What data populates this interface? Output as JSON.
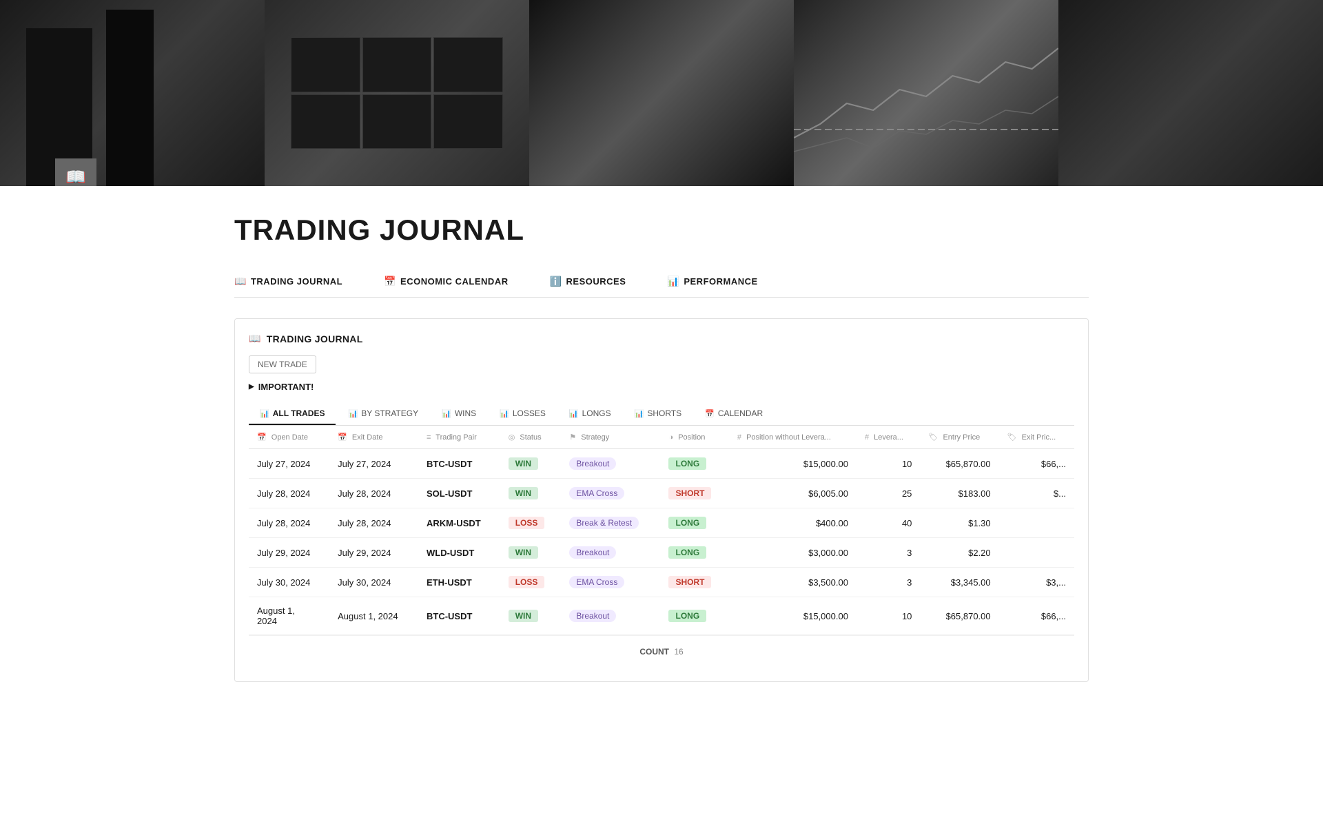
{
  "hero": {
    "segments": [
      {
        "label": "buildings"
      },
      {
        "label": "trading-monitors"
      },
      {
        "label": "skyscrapers"
      },
      {
        "label": "charts"
      },
      {
        "label": "phone-trading"
      }
    ]
  },
  "page": {
    "title": "TRADING JOURNAL",
    "icon": "📖"
  },
  "nav": {
    "items": [
      {
        "id": "trading-journal",
        "icon": "📖",
        "label": "TRADING JOURNAL"
      },
      {
        "id": "economic-calendar",
        "icon": "📅",
        "label": "ECONOMIC CALENDAR"
      },
      {
        "id": "resources",
        "icon": "ℹ️",
        "label": "RESOURCES"
      },
      {
        "id": "performance",
        "icon": "📊",
        "label": "PERFORMANCE"
      }
    ]
  },
  "journal": {
    "title": "TRADING JOURNAL",
    "icon": "📖",
    "new_trade_label": "NEW TRADE",
    "important_label": "IMPORTANT!",
    "tabs": [
      {
        "id": "all-trades",
        "icon": "📊",
        "label": "ALL TRADES",
        "active": true
      },
      {
        "id": "by-strategy",
        "icon": "📊",
        "label": "BY STRATEGY",
        "active": false
      },
      {
        "id": "wins",
        "icon": "📊",
        "label": "WINS",
        "active": false
      },
      {
        "id": "losses",
        "icon": "📊",
        "label": "LOSSES",
        "active": false
      },
      {
        "id": "longs",
        "icon": "📊",
        "label": "LONGS",
        "active": false
      },
      {
        "id": "shorts",
        "icon": "📊",
        "label": "SHORTS",
        "active": false
      },
      {
        "id": "calendar",
        "icon": "📅",
        "label": "CALENDAR",
        "active": false
      }
    ],
    "table": {
      "columns": [
        {
          "id": "open-date",
          "icon": "📅",
          "label": "Open Date"
        },
        {
          "id": "exit-date",
          "icon": "📅",
          "label": "Exit Date"
        },
        {
          "id": "trading-pair",
          "icon": "≡",
          "label": "Trading Pair"
        },
        {
          "id": "status",
          "icon": "◎",
          "label": "Status"
        },
        {
          "id": "strategy",
          "icon": "⚑",
          "label": "Strategy"
        },
        {
          "id": "position",
          "icon": "◑",
          "label": "Position"
        },
        {
          "id": "position-without-leverage",
          "icon": "#",
          "label": "Position without Levera..."
        },
        {
          "id": "leverage",
          "icon": "#",
          "label": "Levera..."
        },
        {
          "id": "entry-price",
          "icon": "🏷",
          "label": "Entry Price"
        },
        {
          "id": "exit-price",
          "icon": "🏷",
          "label": "Exit Pric..."
        }
      ],
      "rows": [
        {
          "open_date": "July 27, 2024",
          "exit_date": "July 27, 2024",
          "trading_pair": "BTC-USDT",
          "status": "WIN",
          "status_type": "win",
          "strategy": "Breakout",
          "position": "LONG",
          "position_type": "long",
          "position_without_leverage": "$15,000.00",
          "leverage": "10",
          "entry_price": "$65,870.00",
          "exit_price": "$66,..."
        },
        {
          "open_date": "July 28, 2024",
          "exit_date": "July 28, 2024",
          "trading_pair": "SOL-USDT",
          "status": "WIN",
          "status_type": "win",
          "strategy": "EMA Cross",
          "position": "SHORT",
          "position_type": "short",
          "position_without_leverage": "$6,005.00",
          "leverage": "25",
          "entry_price": "$183.00",
          "exit_price": "$..."
        },
        {
          "open_date": "July 28, 2024",
          "exit_date": "July 28, 2024",
          "trading_pair": "ARKM-USDT",
          "status": "LOSS",
          "status_type": "loss",
          "strategy": "Break & Retest",
          "position": "LONG",
          "position_type": "long",
          "position_without_leverage": "$400.00",
          "leverage": "40",
          "entry_price": "$1.30",
          "exit_price": ""
        },
        {
          "open_date": "July 29, 2024",
          "exit_date": "July 29, 2024",
          "trading_pair": "WLD-USDT",
          "status": "WIN",
          "status_type": "win",
          "strategy": "Breakout",
          "position": "LONG",
          "position_type": "long",
          "position_without_leverage": "$3,000.00",
          "leverage": "3",
          "entry_price": "$2.20",
          "exit_price": ""
        },
        {
          "open_date": "July 30, 2024",
          "exit_date": "July 30, 2024",
          "trading_pair": "ETH-USDT",
          "status": "LOSS",
          "status_type": "loss",
          "strategy": "EMA Cross",
          "position": "SHORT",
          "position_type": "short",
          "position_without_leverage": "$3,500.00",
          "leverage": "3",
          "entry_price": "$3,345.00",
          "exit_price": "$3,..."
        },
        {
          "open_date": "August 1,\n2024",
          "exit_date": "August 1, 2024",
          "trading_pair": "BTC-USDT",
          "status": "WIN",
          "status_type": "win",
          "strategy": "Breakout",
          "position": "LONG",
          "position_type": "long",
          "position_without_leverage": "$15,000.00",
          "leverage": "10",
          "entry_price": "$65,870.00",
          "exit_price": "$66,..."
        }
      ]
    },
    "count_label": "COUNT",
    "count_value": "16"
  }
}
